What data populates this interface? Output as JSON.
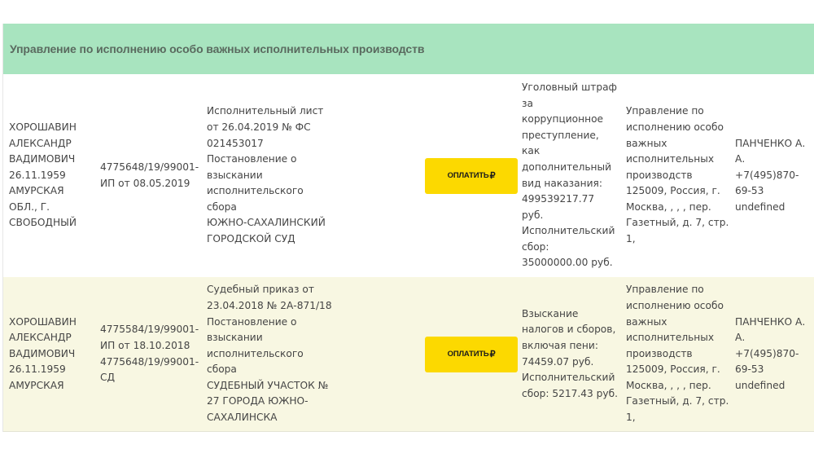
{
  "group": {
    "title": "Управление по исполнению особо важных исполнительных производств",
    "header_color": "#a8e4bf"
  },
  "pay_button": {
    "label": "ОПЛАТИТЬ",
    "currency_icon": "ruble-sign-icon",
    "currency_glyph": "₽",
    "color": "#fcd900"
  },
  "rows": [
    {
      "debtor": "ХОРОШАВИН\nАЛЕКСАНДР\nВАДИМОВИЧ\n26.11.1959\nАМУРСКАЯ\nОБЛ., Г.\nСВОБОДНЫЙ",
      "proceeding": "4775648/19/99001-\nИП от 08.05.2019",
      "document": "Исполнительный лист\nот 26.04.2019 № ФС\n021453017\nПостановление о\nвзыскании\nисполнительского\nсбора\nЮЖНО-САХАЛИНСКИЙ\nГОРОДСКОЙ СУД",
      "subject": "Уголовный штраф\nза\nкоррупционное\nпреступление,\nкак\nдополнительный\nвид наказания:\n499539217.77\nруб.\nИсполнительский\nсбор:\n35000000.00 руб.",
      "department": "Управление по\nисполнению особо\nважных\nисполнительных\nпроизводств\n125009, Россия, г.\nМосква, , , , пер.\nГазетный, д. 7, стр.\n1,",
      "bailiff": "ПАНЧЕНКО А.\nА.\n+7(495)870-\n69-53\nundefined"
    },
    {
      "debtor": "ХОРОШАВИН\nАЛЕКСАНДР\nВАДИМОВИЧ\n26.11.1959\nАМУРСКАЯ",
      "proceeding": "4775584/19/99001-\nИП от 18.10.2018\n4775648/19/99001-\nСД",
      "document": "Судебный приказ от\n23.04.2018 № 2А-871/18\nПостановление о\nвзыскании\nисполнительского\nсбора\nСУДЕБНЫЙ УЧАСТОК №\n 27 ГОРОДА ЮЖНО-\nСАХАЛИНСКА",
      "subject": "Взыскание\nналогов и сборов,\nвключая пени:\n74459.07 руб.\nИсполнительский\nсбор: 5217.43 руб.",
      "department": "Управление по\nисполнению особо\nважных\nисполнительных\nпроизводств\n125009, Россия, г.\nМосква, , , , пер.\nГазетный, д. 7, стр.\n1,",
      "bailiff": "ПАНЧЕНКО А.\nА.\n+7(495)870-\n69-53\nundefined"
    }
  ]
}
